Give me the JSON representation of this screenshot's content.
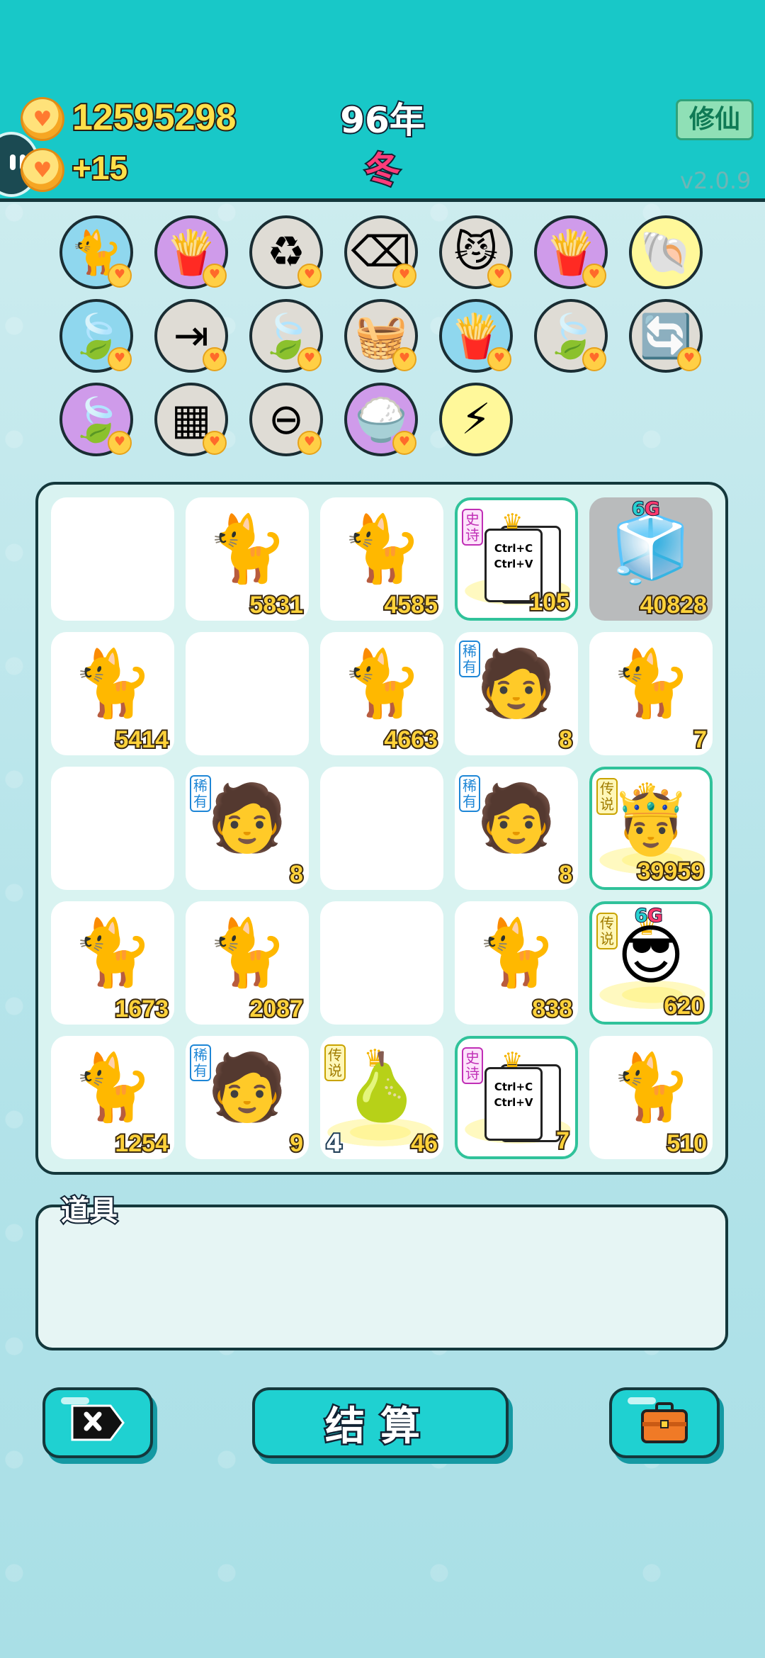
{
  "header": {
    "coins": "12595298",
    "income": "+15",
    "year": "96年",
    "season": "冬",
    "mode_button": "修仙",
    "version": "v2.0.9"
  },
  "items": [
    {
      "icon": "cat-icon",
      "glyph": "🐈",
      "color": "blue"
    },
    {
      "icon": "fries-icon",
      "glyph": "🍟",
      "color": "purple"
    },
    {
      "icon": "recycle-icon",
      "glyph": "♻",
      "color": "grey"
    },
    {
      "icon": "delete-tag-icon",
      "glyph": "⌫",
      "color": "grey"
    },
    {
      "icon": "owl-cats-icon",
      "glyph": "😼",
      "color": "grey"
    },
    {
      "icon": "fries-icon",
      "glyph": "🍟",
      "color": "purple"
    },
    {
      "icon": "shell-icon",
      "glyph": "🐚",
      "color": "yellow"
    },
    {
      "icon": "leaf-icon",
      "glyph": "🍃",
      "color": "blue"
    },
    {
      "icon": "skip-icon",
      "glyph": "⇥",
      "color": "grey"
    },
    {
      "icon": "leaf-icon",
      "glyph": "🍃",
      "color": "grey"
    },
    {
      "icon": "fruit-basket-icon",
      "glyph": "🧺",
      "color": "grey"
    },
    {
      "icon": "fries-icon",
      "glyph": "🍟",
      "color": "blue"
    },
    {
      "icon": "leaf-icon",
      "glyph": "🍃",
      "color": "grey"
    },
    {
      "icon": "refresh-icon",
      "glyph": "🔄",
      "color": "grey"
    },
    {
      "icon": "leaf-icon",
      "glyph": "🍃",
      "color": "purple"
    },
    {
      "icon": "sugar-cubes-icon",
      "glyph": "▦",
      "color": "grey"
    },
    {
      "icon": "minus-icon",
      "glyph": "⊖",
      "color": "grey"
    },
    {
      "icon": "rice-bowl-icon",
      "glyph": "🍚",
      "color": "purple"
    },
    {
      "icon": "lightning-icon",
      "glyph": "⚡",
      "color": "yellow"
    }
  ],
  "grid": [
    {
      "type": "empty"
    },
    {
      "type": "cat",
      "value": "5831"
    },
    {
      "type": "cat",
      "value": "4585"
    },
    {
      "type": "ctrl",
      "value": "105",
      "tag": "史诗",
      "tagType": "epic",
      "highlight": true,
      "lines": [
        "Ctrl+C",
        "Ctrl+V"
      ]
    },
    {
      "type": "fridge",
      "value": "40828",
      "badge": "6",
      "badgeB": "G",
      "grey": true
    },
    {
      "type": "cat",
      "value": "5414"
    },
    {
      "type": "empty"
    },
    {
      "type": "cat",
      "value": "4663"
    },
    {
      "type": "face",
      "value": "8",
      "tag": "稀有",
      "tagType": "rare"
    },
    {
      "type": "cat",
      "value": "7"
    },
    {
      "type": "empty"
    },
    {
      "type": "face",
      "value": "8",
      "tag": "稀有",
      "tagType": "rare"
    },
    {
      "type": "empty"
    },
    {
      "type": "face",
      "value": "8",
      "tag": "稀有",
      "tagType": "rare"
    },
    {
      "type": "king",
      "value": "39959",
      "tag": "传说",
      "tagType": "legend",
      "highlight": true
    },
    {
      "type": "cat",
      "value": "1673"
    },
    {
      "type": "cat",
      "value": "2087"
    },
    {
      "type": "empty"
    },
    {
      "type": "cat",
      "value": "838"
    },
    {
      "type": "sunglasses",
      "value": "620",
      "tag": "传说",
      "tagType": "legend",
      "highlight": true,
      "badge": "6",
      "badgeB": "G"
    },
    {
      "type": "cat",
      "value": "1254"
    },
    {
      "type": "face",
      "value": "9",
      "tag": "稀有",
      "tagType": "rare"
    },
    {
      "type": "pear",
      "value": "46",
      "left": "4",
      "tag": "传说",
      "tagType": "legend"
    },
    {
      "type": "ctrl",
      "value": "7",
      "tag": "史诗",
      "tagType": "epic",
      "highlight": true,
      "lines": [
        "Ctrl+C",
        "Ctrl+V"
      ]
    },
    {
      "type": "cat",
      "value": "510"
    }
  ],
  "tools": {
    "label": "道具"
  },
  "buttons": {
    "settle": "结算"
  }
}
